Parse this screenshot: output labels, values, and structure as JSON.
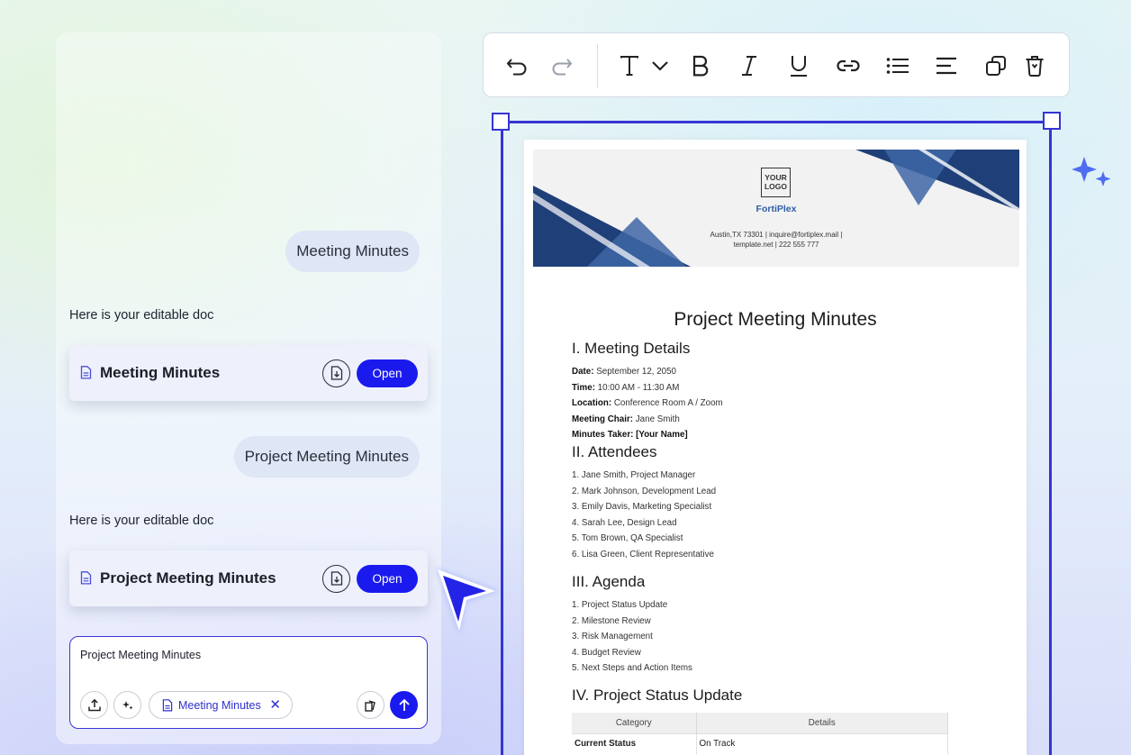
{
  "chat": {
    "messages": [
      {
        "user": "Meeting Minutes",
        "bot": "Here is your editable doc",
        "doc_title": "Meeting Minutes",
        "open_label": "Open"
      },
      {
        "user": "Project Meeting Minutes",
        "bot": "Here is your editable doc",
        "doc_title": "Project Meeting Minutes",
        "open_label": "Open"
      }
    ],
    "input": {
      "text": "Project Meeting Minutes",
      "chip_label": "Meeting Minutes",
      "chip_close": "✕"
    }
  },
  "toolbar": {
    "icons": [
      "undo-icon",
      "redo-icon",
      "text-style-icon",
      "chevron-down-icon",
      "bold-icon",
      "italic-icon",
      "underline-icon",
      "link-icon",
      "bullet-list-icon",
      "align-left-icon",
      "duplicate-icon",
      "delete-icon"
    ]
  },
  "document": {
    "header": {
      "logo_line1": "YOUR",
      "logo_line2": "LOGO",
      "company": "FortiPlex",
      "address_line1": "Austin,TX 73301 | inquire@fortiplex.mail |",
      "address_line2": "template.net | 222 555 777"
    },
    "title": "Project Meeting Minutes",
    "sections": {
      "details_heading": "I. Meeting Details",
      "details": [
        {
          "label": "Date:",
          "value": " September 12, 2050"
        },
        {
          "label": "Time:",
          "value": " 10:00 AM - 11:30 AM"
        },
        {
          "label": "Location:",
          "value": " Conference Room A / Zoom"
        },
        {
          "label": "Meeting Chair:",
          "value": " Jane Smith"
        },
        {
          "label": "Minutes Taker: [Your Name]",
          "value": ""
        }
      ],
      "attendees_heading": "II. Attendees",
      "attendees": [
        "1. Jane Smith, Project Manager",
        "2. Mark Johnson, Development Lead",
        "3. Emily Davis, Marketing Specialist",
        "4. Sarah Lee, Design Lead",
        "5. Tom Brown, QA Specialist",
        "6. Lisa Green, Client Representative"
      ],
      "agenda_heading": "III. Agenda",
      "agenda": [
        "1. Project Status Update",
        "2. Milestone Review",
        "3. Risk Management",
        "4. Budget Review",
        "5. Next Steps and Action Items"
      ],
      "status_heading": "IV. Project Status Update",
      "status_table": {
        "headers": [
          "Category",
          "Details"
        ],
        "rows": [
          [
            "Current Status",
            "On Track"
          ]
        ]
      }
    }
  },
  "colors": {
    "accent": "#1a1aee",
    "selection": "#3535d4",
    "header_dark_blue": "#1f3f78",
    "header_mid_blue": "#3e66a6",
    "company_blue": "#2f5ea8"
  }
}
